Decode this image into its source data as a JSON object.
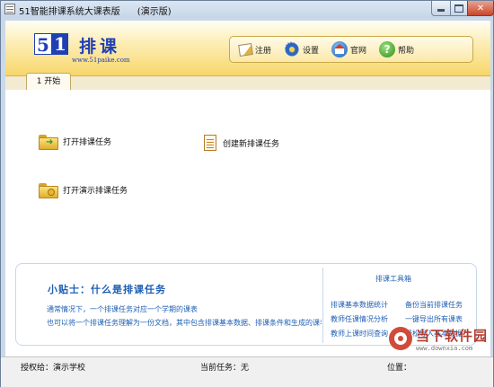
{
  "window": {
    "title": "51智能排课系统大课表版      (演示版)"
  },
  "header": {
    "logo_digit_5": "5",
    "logo_digit_1": "1",
    "logo_text": "排课",
    "logo_url": "www.51paike.com",
    "toolbar": [
      {
        "label": "注册",
        "icon": "register-icon"
      },
      {
        "label": "设置",
        "icon": "gear-icon"
      },
      {
        "label": "官网",
        "icon": "home-globe-icon"
      },
      {
        "label": "帮助",
        "icon": "help-icon"
      }
    ]
  },
  "tabs": [
    {
      "label": "1 开始"
    }
  ],
  "actions": [
    {
      "label": "打开排课任务",
      "icon": "folder-open-icon"
    },
    {
      "label": "创建新排课任务",
      "icon": "document-icon"
    },
    {
      "label": "打开演示排课任务",
      "icon": "folder-key-icon"
    }
  ],
  "tips": {
    "title": "小贴士：什么是排课任务",
    "lines": [
      "通常情况下，一个排课任务对应一个学期的课表",
      "也可以将一个排课任务理解为一份文档，其中包含排课基本数据、排课条件和生成的课表"
    ]
  },
  "toolbox": {
    "title": "排课工具箱",
    "links": [
      "排课基本数据统计",
      "备份当前排课任务",
      "教师任课情况分析",
      "一键导出所有课表",
      "教师上课时间查询",
      "轻松导入基本数据"
    ]
  },
  "status": {
    "licensed_to": "授权给：演示学校",
    "current_task": "当前任务：无",
    "position": "位置："
  },
  "watermark": {
    "main": "当下软件园",
    "sub": "www.downxia.com"
  },
  "colors": {
    "accent_blue": "#1f5fb5",
    "header_gold": "#f7d66a",
    "close_red": "#c9452a"
  }
}
